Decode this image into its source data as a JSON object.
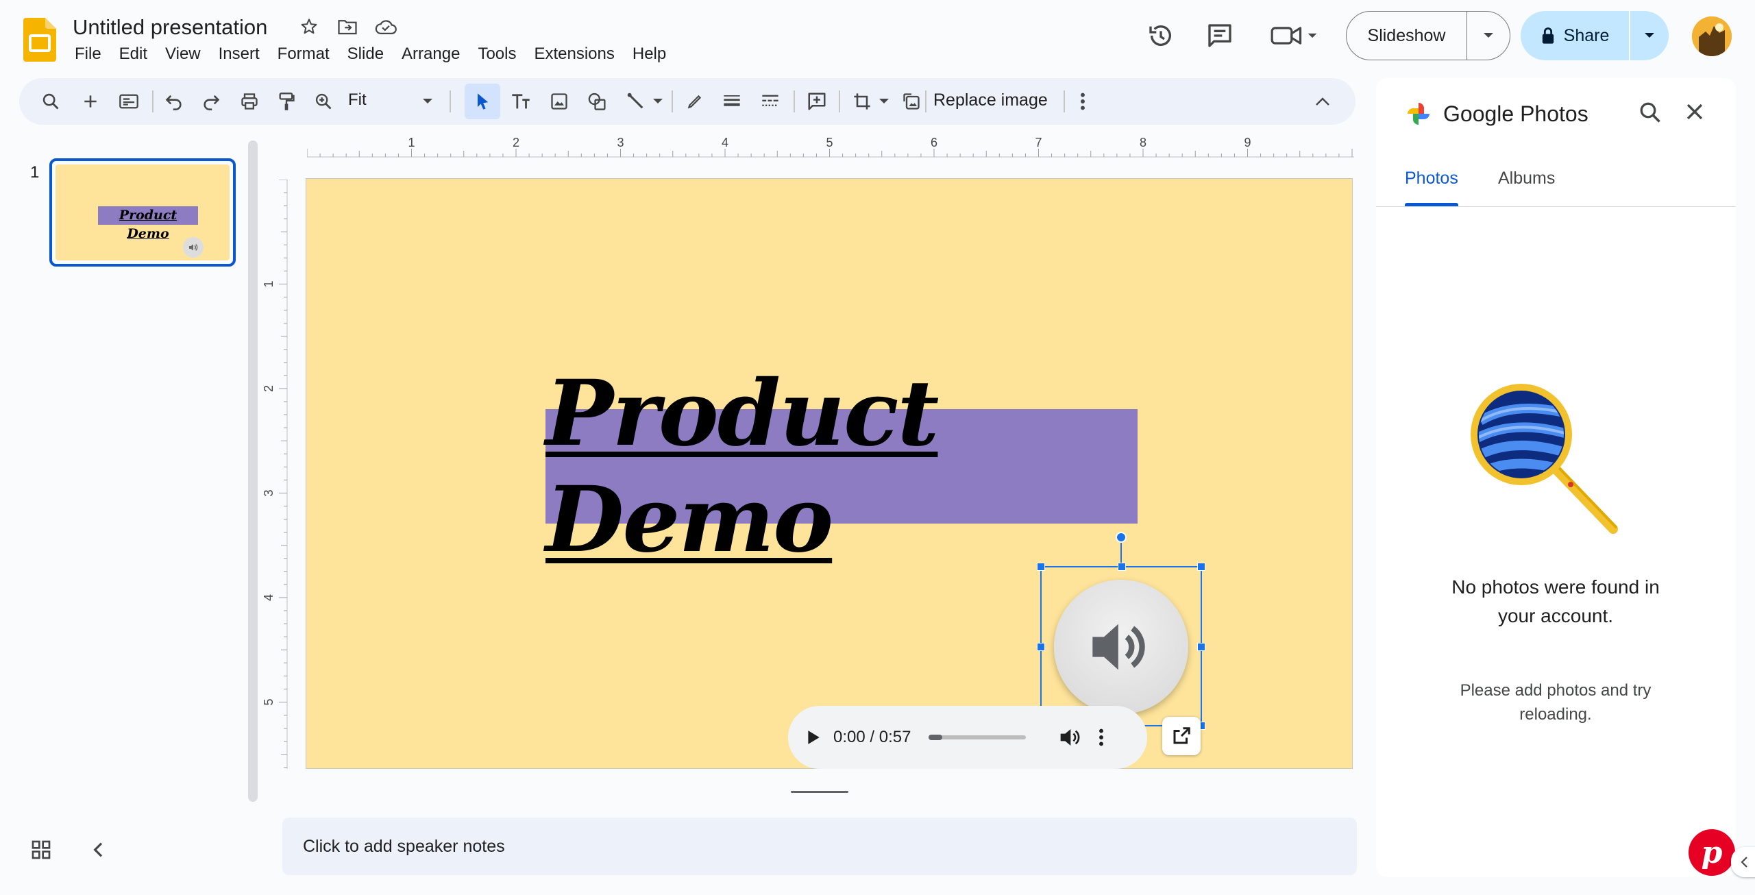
{
  "app": {
    "doc_title": "Untitled presentation",
    "menu": [
      "File",
      "Edit",
      "View",
      "Insert",
      "Format",
      "Slide",
      "Arrange",
      "Tools",
      "Extensions",
      "Help"
    ]
  },
  "header": {
    "slideshow_label": "Slideshow",
    "share_label": "Share"
  },
  "toolbar": {
    "zoom_value": "Fit",
    "replace_image_label": "Replace image"
  },
  "filmstrip": {
    "slide_number": "1",
    "thumb_title": "Product Demo"
  },
  "rulers": {
    "horizontal": [
      "1",
      "2",
      "3",
      "4",
      "5",
      "6",
      "7",
      "8",
      "9"
    ],
    "vertical": [
      "1",
      "2",
      "3",
      "4",
      "5"
    ]
  },
  "slide": {
    "title": "Product Demo",
    "background_color": "#fee49a",
    "title_box_color": "#8e7cc3"
  },
  "audio_player": {
    "time": "0:00 / 0:57",
    "progress": 0.0
  },
  "notes": {
    "placeholder": "Click to add speaker notes"
  },
  "side_panel": {
    "title": "Google Photos",
    "tabs": [
      "Photos",
      "Albums"
    ],
    "active_tab": "Photos",
    "empty_title": "No photos were found in your account.",
    "empty_subtitle": "Please add photos and try reloading."
  },
  "colors": {
    "accent": "#0b57d0",
    "share_bg": "#c2e7ff",
    "selection": "#1a73e8"
  }
}
